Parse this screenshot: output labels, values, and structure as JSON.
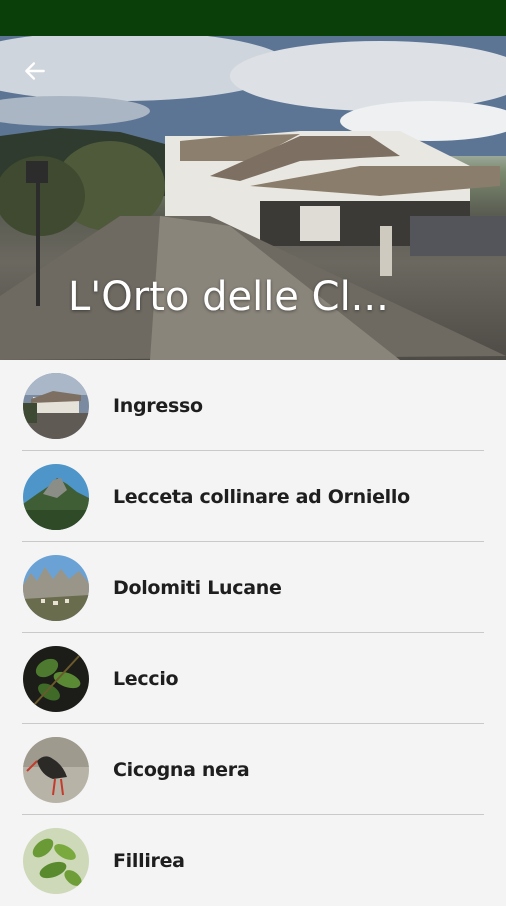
{
  "status_bar": {
    "color": "#0a3f0a"
  },
  "header": {
    "title": "L'Orto delle Cl...",
    "back_icon": "arrow-left-icon"
  },
  "list": {
    "items": [
      {
        "label": "Ingresso",
        "thumb": "building-photo"
      },
      {
        "label": "Lecceta collinare ad Orniello",
        "thumb": "hill-photo"
      },
      {
        "label": "Dolomiti Lucane",
        "thumb": "mountains-photo"
      },
      {
        "label": "Leccio",
        "thumb": "leaves-photo"
      },
      {
        "label": "Cicogna nera",
        "thumb": "stork-photo"
      },
      {
        "label": "Fillirea",
        "thumb": "shrub-photo"
      }
    ]
  }
}
